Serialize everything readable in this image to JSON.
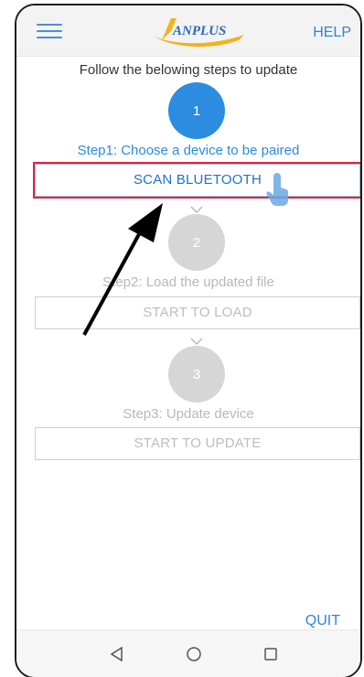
{
  "appbar": {
    "logo_text": "ANPLUS",
    "help_label": "HELP"
  },
  "intro": "Follow the belowing steps to update",
  "steps": [
    {
      "number": "1",
      "label": "Step1: Choose a device to be paired",
      "button": "SCAN BLUETOOTH",
      "state": "active"
    },
    {
      "number": "2",
      "label": "Step2: Load the updated file",
      "button": "START TO LOAD",
      "state": "inactive"
    },
    {
      "number": "3",
      "label": "Step3: Update device",
      "button": "START TO UPDATE",
      "state": "inactive"
    }
  ],
  "quit_label": "QUIT",
  "icons": {
    "menu": "hamburger-menu-icon",
    "pointer": "hand-pointer-icon",
    "chevron": "chevron-down-icon",
    "nav_back": "triangle-back-icon",
    "nav_home": "circle-home-icon",
    "nav_recent": "square-recent-icon"
  },
  "colors": {
    "accent": "#2b8ce0",
    "inactive": "#d6d6d6",
    "highlight": "#e0233a"
  }
}
